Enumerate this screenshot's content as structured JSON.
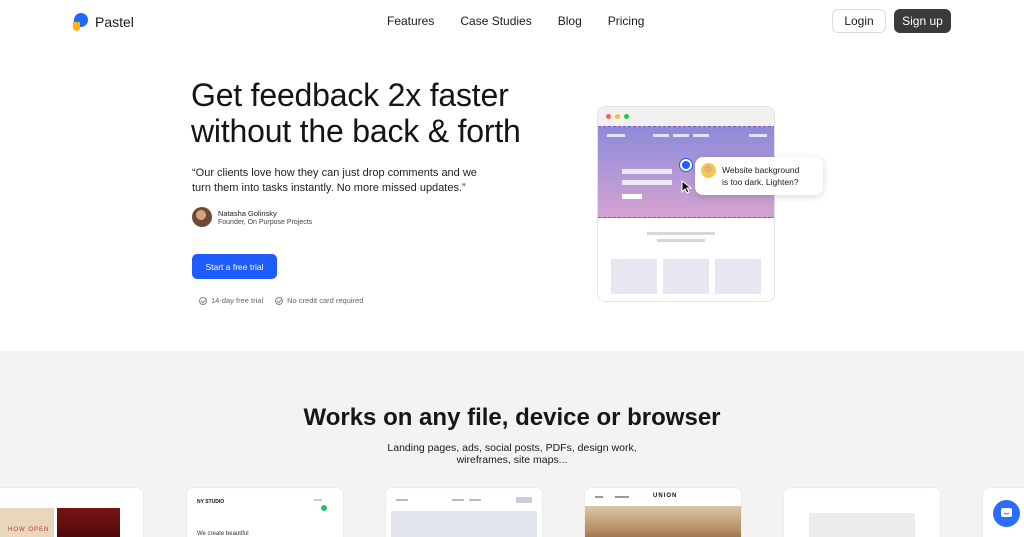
{
  "nav": {
    "brand": "Pastel",
    "links": [
      "Features",
      "Case Studies",
      "Blog",
      "Pricing"
    ],
    "login": "Login",
    "signup": "Sign up"
  },
  "hero": {
    "title_line1": "Get feedback 2x faster",
    "title_line2": "without the back & forth",
    "quote_line1": "“Our clients love how they can just drop comments and we",
    "quote_line2": "turn them into tasks instantly. No more missed updates.”",
    "author_name": "Natasha Golinsky",
    "author_role": "Founder, On Purpose Projects",
    "cta": "Start a free trial",
    "perk1": "14-day free trial",
    "perk2": "No credit card required"
  },
  "mockup": {
    "comment_line1": "Website background",
    "comment_line2": "is too dark. Lighten?"
  },
  "section2": {
    "title": "Works on any file, device or browser",
    "subtitle_line1": "Landing pages, ads, social posts, PDFs, design work,",
    "subtitle_line2": "wireframes, site maps...",
    "card_labels": [
      "HOW OPEN",
      "NY STUDIO",
      "We create beautiful",
      "UNION"
    ]
  },
  "colors": {
    "accent": "#1f5cff",
    "dark_button": "#3a3a3a",
    "section_bg": "#f4f3f1"
  },
  "icons": {
    "chat": "chat-bubble-icon",
    "check": "check-circle-icon",
    "cursor": "cursor-arrow-icon"
  }
}
